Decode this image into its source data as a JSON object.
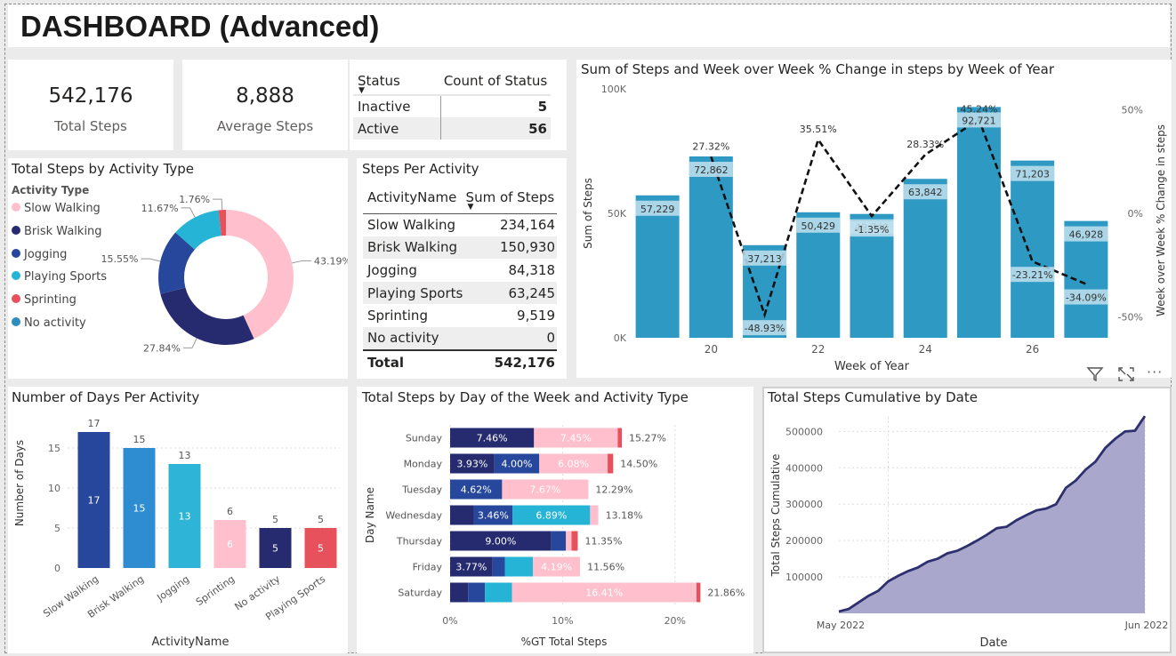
{
  "page_title": "DASHBOARD (Advanced)",
  "kpis": [
    {
      "value": "542,176",
      "label": "Total Steps"
    },
    {
      "value": "8,888",
      "label": "Average Steps"
    }
  ],
  "status_table": {
    "headers": [
      "Status",
      "Count of Status"
    ],
    "rows": [
      [
        "Inactive",
        "5"
      ],
      [
        "Active",
        "56"
      ]
    ]
  },
  "steps_per_activity_table": {
    "title": "Steps Per Activity",
    "headers": [
      "ActivityName",
      "Sum of Steps"
    ],
    "rows": [
      [
        "Slow Walking",
        "234,164"
      ],
      [
        "Brisk Walking",
        "150,930"
      ],
      [
        "Jogging",
        "84,318"
      ],
      [
        "Playing Sports",
        "63,245"
      ],
      [
        "Sprinting",
        "9,519"
      ],
      [
        "No activity",
        "0"
      ]
    ],
    "total": [
      "Total",
      "542,176"
    ]
  },
  "visual_header_icons": [
    "filter-icon",
    "focus-mode-icon",
    "more-options-icon"
  ],
  "colors": {
    "slow_walking": "#ffbfcc",
    "brisk_walking": "#262b70",
    "jogging": "#26479c",
    "playing_sports": "#26b4d6",
    "sprinting": "#e6515c",
    "no_activity": "#2e8cbf",
    "bar": "#2e9ac4",
    "area": "#a9a7cb",
    "area_line": "#2e2f6f"
  },
  "chart_data": [
    {
      "type": "pie",
      "title": "Total Steps by Activity Type",
      "legend_title": "Activity Type",
      "legend_position": "left",
      "categories": [
        "Slow Walking",
        "Brisk Walking",
        "Jogging",
        "Playing Sports",
        "Sprinting",
        "No activity"
      ],
      "values": [
        234164,
        150930,
        84318,
        63245,
        9519,
        0
      ],
      "labels": [
        "43.19%",
        "27.84%",
        "15.55%",
        "11.67%",
        "1.76%",
        ""
      ]
    },
    {
      "type": "bar",
      "title": "Sum of Steps and Week over Week % Change in steps by Week of Year",
      "xlabel": "Week of Year",
      "ylabel": "Sum of Steps",
      "y2label": "Week over Week % Change in steps",
      "x": [
        19,
        20,
        21,
        22,
        23,
        24,
        25,
        26,
        27
      ],
      "x_ticks": [
        "20",
        "22",
        "24",
        "26"
      ],
      "y_ticks": [
        "0K",
        "50K",
        "100K"
      ],
      "y2_ticks": [
        "-50%",
        "0%",
        "50%"
      ],
      "ylim": [
        0,
        100000
      ],
      "y2lim": [
        -60,
        60
      ],
      "series": [
        {
          "name": "Sum of Steps",
          "values": [
            57229,
            72862,
            37213,
            50429,
            49749,
            63842,
            92721,
            71203,
            46928
          ],
          "labels": [
            "57,229",
            "72,862",
            "37,213",
            "50,429",
            "49,749",
            "63,842",
            "92,721",
            "71,203",
            "46,928"
          ]
        },
        {
          "name": "Week over Week % Change in steps",
          "type": "line",
          "values": [
            null,
            27.32,
            -48.93,
            35.51,
            -1.35,
            28.33,
            45.24,
            -23.21,
            -34.09
          ],
          "labels": [
            "",
            "27.32%",
            "-48.93%",
            "35.51%",
            "-1.35%",
            "28.33%",
            "45.24%",
            "-23.21%",
            "-34.09%"
          ]
        }
      ]
    },
    {
      "type": "bar",
      "title": "Number of Days Per Activity",
      "xlabel": "ActivityName",
      "ylabel": "Number of Days",
      "categories": [
        "Slow Walking",
        "Brisk Walking",
        "Jogging",
        "Sprinting",
        "No activity",
        "Playing Sports"
      ],
      "values": [
        17,
        15,
        13,
        6,
        5,
        5
      ],
      "y_ticks": [
        "0",
        "5",
        "10",
        "15"
      ],
      "ylim": [
        0,
        19
      ]
    },
    {
      "type": "bar",
      "orientation": "horizontal-stacked",
      "title": "Total Steps by Day of the Week and Activity Type",
      "xlabel": "%GT Total Steps",
      "ylabel": "Day Name",
      "x_ticks": [
        "0%",
        "10%",
        "20%"
      ],
      "xlim": [
        0,
        25
      ],
      "categories": [
        "Sunday",
        "Monday",
        "Tuesday",
        "Wednesday",
        "Thursday",
        "Friday",
        "Saturday"
      ],
      "series": [
        {
          "name": "Brisk Walking",
          "values": [
            7.46,
            3.93,
            0,
            2.1,
            9.0,
            3.77,
            1.6
          ],
          "labels": [
            "7.46%",
            "3.93%",
            "",
            "",
            "9.00%",
            "3.77%",
            ""
          ]
        },
        {
          "name": "Jogging",
          "values": [
            0,
            4.0,
            4.62,
            3.46,
            1.3,
            1.1,
            1.5
          ],
          "labels": [
            "",
            "4.00%",
            "4.62%",
            "3.46%",
            "",
            "",
            ""
          ]
        },
        {
          "name": "Playing Sports",
          "values": [
            0,
            0,
            0,
            6.89,
            0,
            2.5,
            2.4
          ],
          "labels": [
            "",
            "",
            "",
            "6.89%",
            "",
            "",
            ""
          ]
        },
        {
          "name": "Slow Walking",
          "values": [
            7.45,
            6.08,
            7.67,
            0.73,
            0.5,
            4.19,
            16.41
          ],
          "labels": [
            "7.45%",
            "6.08%",
            "7.67%",
            "",
            "",
            "4.19%",
            "16.41%"
          ]
        },
        {
          "name": "Sprinting",
          "values": [
            0.36,
            0.49,
            0,
            0,
            0.55,
            0,
            0.35
          ],
          "labels": [
            "",
            "",
            "",
            "",
            "",
            "",
            ""
          ]
        }
      ],
      "totals": [
        "15.27%",
        "14.50%",
        "12.29%",
        "13.18%",
        "11.35%",
        "11.56%",
        "21.86%"
      ]
    },
    {
      "type": "area",
      "title": "Total Steps Cumulative by Date",
      "xlabel": "Date",
      "ylabel": "Total Steps Cumulative",
      "x_ticks": [
        "May 2022",
        "Jun 2022"
      ],
      "y_ticks": [
        "100000",
        "200000",
        "300000",
        "400000",
        "500000"
      ],
      "ylim": [
        0,
        540000
      ],
      "x": [
        "2022-05-01",
        "2022-05-02",
        "2022-05-03",
        "2022-05-04",
        "2022-05-05",
        "2022-05-06",
        "2022-05-07",
        "2022-05-08",
        "2022-05-09",
        "2022-05-10",
        "2022-05-11",
        "2022-05-12",
        "2022-05-13",
        "2022-05-14",
        "2022-05-15",
        "2022-05-16",
        "2022-05-17",
        "2022-05-18",
        "2022-05-19",
        "2022-05-20",
        "2022-05-21",
        "2022-05-22",
        "2022-05-23",
        "2022-05-24",
        "2022-05-25",
        "2022-05-26",
        "2022-05-27",
        "2022-05-28",
        "2022-05-29",
        "2022-05-30",
        "2022-05-31",
        "2022-06-01"
      ],
      "values": [
        5000,
        12000,
        30000,
        48000,
        62000,
        88000,
        103000,
        116000,
        126000,
        142000,
        150000,
        165000,
        172000,
        185000,
        200000,
        216000,
        234000,
        238000,
        256000,
        270000,
        283000,
        288000,
        300000,
        345000,
        365000,
        395000,
        417000,
        455000,
        480000,
        500000,
        502000,
        542176
      ]
    }
  ]
}
